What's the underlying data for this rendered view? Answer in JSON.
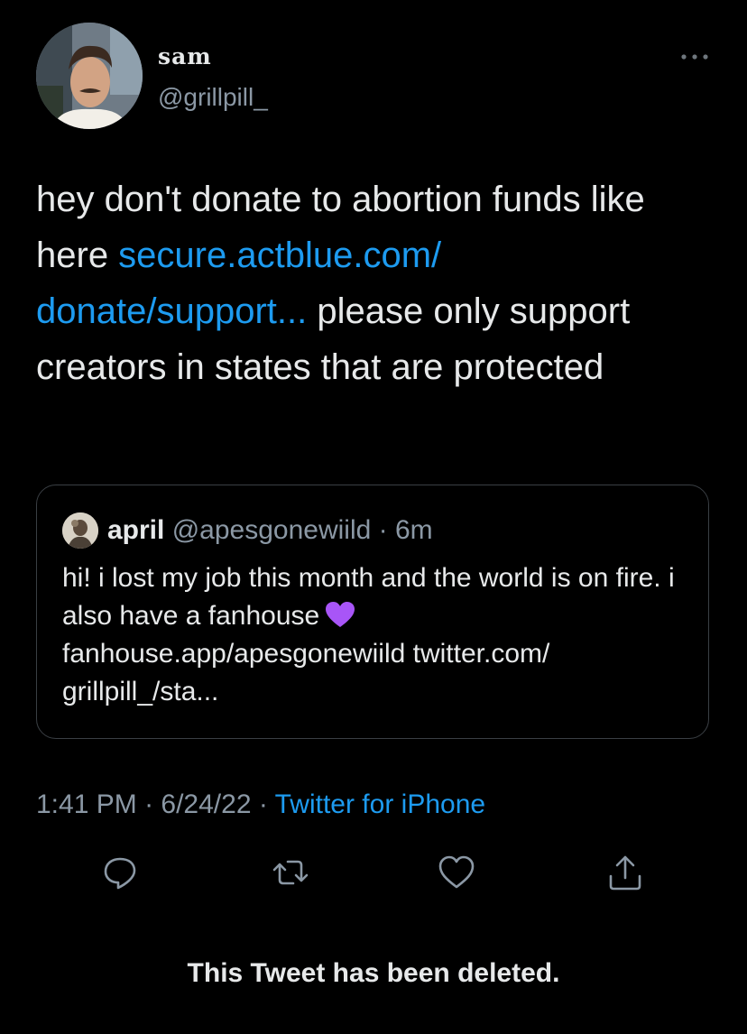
{
  "author": {
    "display_name": "sam",
    "handle": "@grillpill_",
    "avatar_icon": "profile-photo",
    "more_icon": "more-options-icon"
  },
  "tweet": {
    "text_1": "hey don't donate to abortion funds like here ",
    "link": "secure.actblue.com/ donate/support...",
    "text_2": " please only support creators in states that are protected"
  },
  "quote": {
    "name": "april",
    "handle": "@apesgonewiild",
    "separator": " · ",
    "time": "6m",
    "text": "hi! i lost my job this month and the world is on fire. i also have a fanhouse",
    "emoji": "purple-heart",
    "text_2": "fanhouse.app/apesgonewiild twitter.com/ grillpill_/sta..."
  },
  "meta": {
    "time": "1:41 PM",
    "sep1": " · ",
    "date": "6/24/22",
    "sep2": " · ",
    "source": "Twitter for iPhone"
  },
  "actions": {
    "reply_icon": "reply-icon",
    "retweet_icon": "retweet-icon",
    "like_icon": "like-icon",
    "share_icon": "share-icon"
  },
  "deleted_notice": "This Tweet has been deleted.",
  "colors": {
    "background": "#000000",
    "text": "#e7e9ea",
    "secondary": "#8b98a5",
    "link": "#1d9bf0",
    "border": "#3a3f44"
  }
}
